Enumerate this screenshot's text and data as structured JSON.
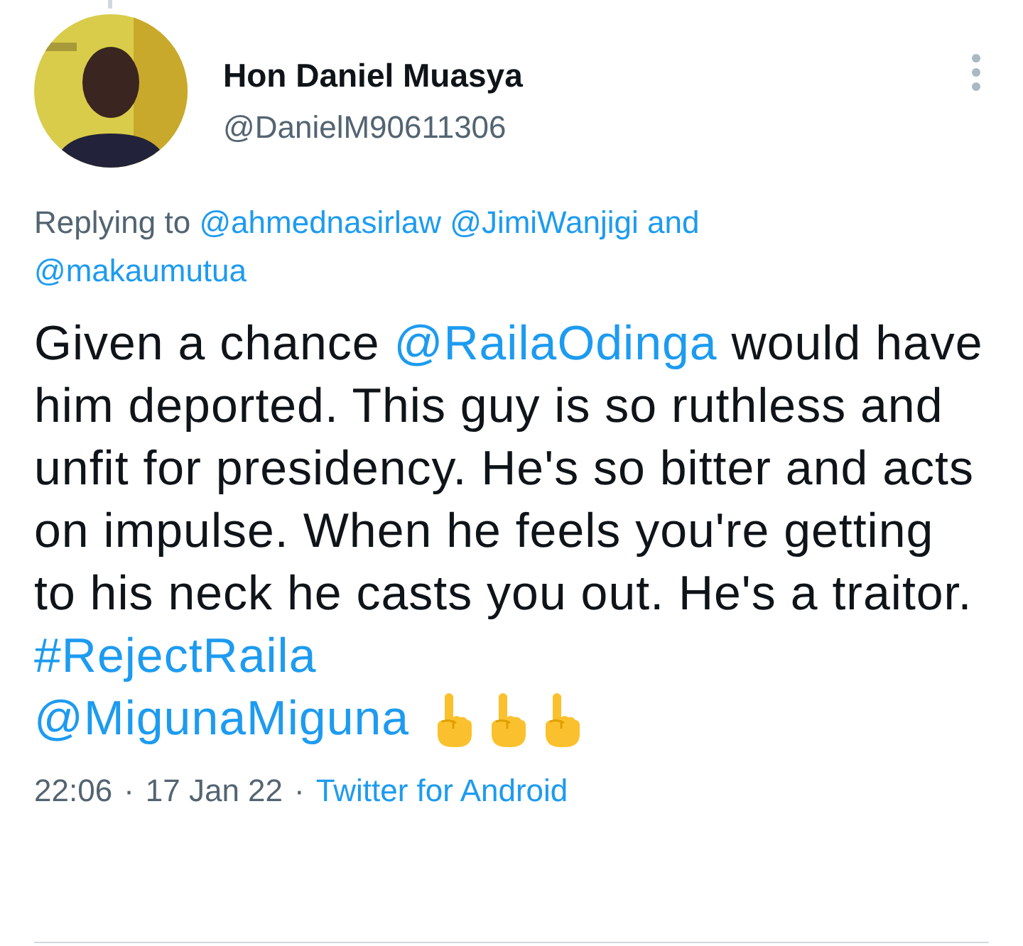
{
  "author": {
    "name": "Hon Daniel Muasya",
    "handle": "@DanielM90611306"
  },
  "reply": {
    "prefix": "Replying to",
    "mentions": [
      "@ahmednasirlaw",
      "@JimiWanjigi"
    ],
    "joiner": "and",
    "last": "@makaumutua"
  },
  "body": [
    {
      "kind": "text",
      "text": "Given a chance "
    },
    {
      "kind": "mention",
      "text": "@RailaOdinga"
    },
    {
      "kind": "text",
      "text": " would have him deported. This guy is so ruthless and  unfit for presidency. He's so bitter and acts on impulse. When he feels you're getting to his neck he casts you out. He's a traitor."
    }
  ],
  "hashtag": "#RejectRaila",
  "tag_line": {
    "mention": "@MigunaMiguna",
    "emojis": [
      {
        "kind": "point_up"
      },
      {
        "kind": "point_up"
      },
      {
        "kind": "point_up"
      }
    ]
  },
  "meta": {
    "time": "22:06",
    "separator": "·",
    "date": "17 Jan 22",
    "source": "Twitter for Android"
  }
}
